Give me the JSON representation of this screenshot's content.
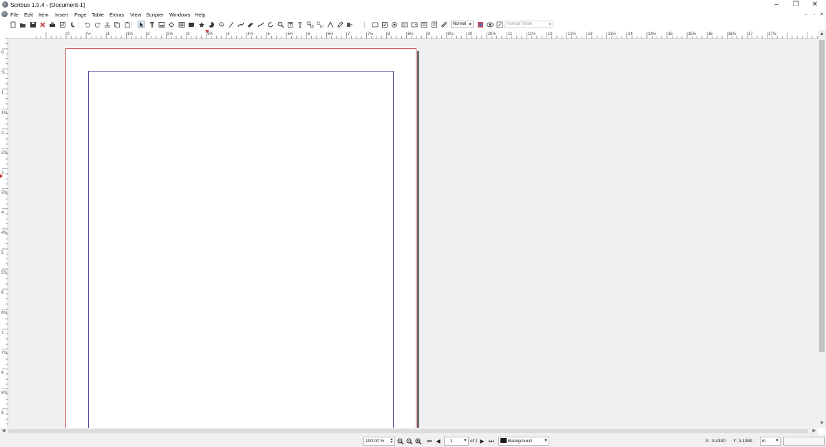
{
  "window": {
    "title": "Scribus 1.5.4 - [Document-1]",
    "controls": {
      "minimize": "–",
      "restore": "❐",
      "close": "✕"
    }
  },
  "menubar": {
    "items": [
      "File",
      "Edit",
      "Item",
      "Insert",
      "Page",
      "Table",
      "Extras",
      "View",
      "Scripter",
      "Windows",
      "Help"
    ],
    "mdi_controls": {
      "minimize": "–",
      "restore": "▫",
      "close": "✕"
    }
  },
  "toolbar": {
    "tools": [
      "new-document-icon",
      "open-icon",
      "save-icon",
      "close-document-icon",
      "print-icon",
      "preflight-icon",
      "export-pdf-icon",
      "undo-icon",
      "redo-icon",
      "cut-icon",
      "copy-icon",
      "paste-icon",
      "select-icon",
      "text-frame-icon",
      "image-frame-icon",
      "render-frame-icon",
      "table-icon",
      "shape-icon",
      "polygon-icon",
      "arc-icon",
      "spiral-icon",
      "line-icon",
      "bezier-icon",
      "freehand-icon",
      "calligraphic-icon",
      "rotate-icon",
      "zoom-icon",
      "edit-contents-icon",
      "edit-text-icon",
      "link-frames-icon",
      "unlink-frames-icon",
      "measure-icon",
      "eyedropper-icon",
      "copy-properties-icon",
      "pdf-pushbutton-icon",
      "pdf-checkbox-icon",
      "pdf-radio-icon",
      "pdf-textfield-icon",
      "pdf-combobox-icon",
      "pdf-listbox-icon",
      "pdf-text-annotation-icon",
      "pdf-link-annotation-icon"
    ],
    "image_mode": "Normal",
    "vision_mode": "Normal Vision"
  },
  "ruler": {
    "horizontal_labels": [
      "0",
      "½",
      "1",
      "1½",
      "2",
      "2½",
      "3",
      "3½",
      "4",
      "4½",
      "5",
      "5½",
      "6",
      "6½",
      "7",
      "7½",
      "8",
      "8½",
      "9",
      "9½",
      "10",
      "10½",
      "11",
      "11½",
      "12",
      "12½",
      "13",
      "13½",
      "14",
      "14½",
      "15",
      "15½",
      "16",
      "16½",
      "17",
      "17½"
    ],
    "vertical_labels": [
      "0",
      "½",
      "1",
      "1½",
      "2",
      "2½",
      "3",
      "3½",
      "4",
      "4½",
      "5",
      "5½",
      "6",
      "6½",
      "7",
      "7½",
      "8",
      "8½",
      "9"
    ]
  },
  "statusbar": {
    "zoom": "100.00 %",
    "page_number": "1",
    "page_of": "of 1",
    "layer": "Background",
    "x_label": "X:",
    "x_value": "3.4340",
    "y_label": "Y:",
    "y_value": "3.1389",
    "unit": "in"
  }
}
